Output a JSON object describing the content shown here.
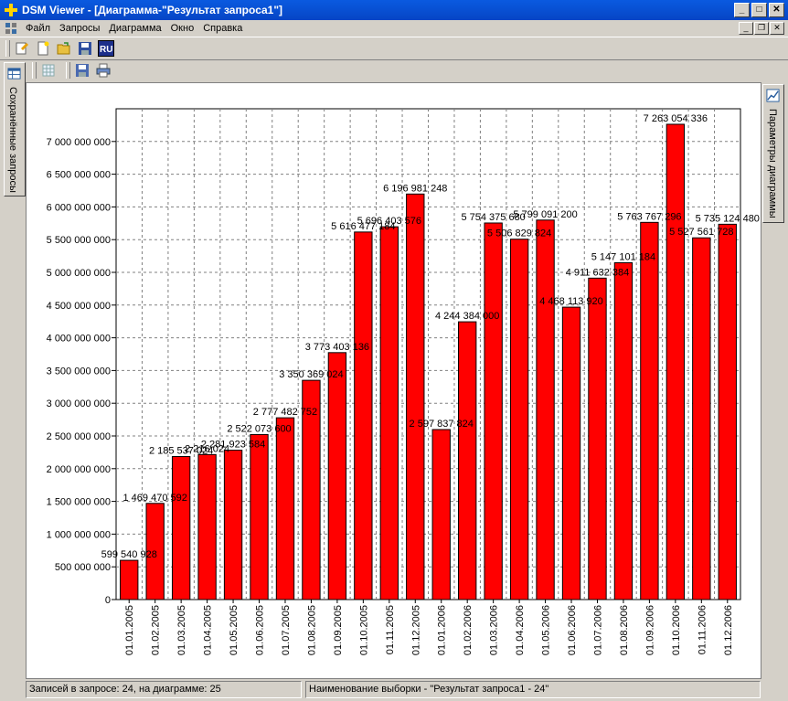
{
  "window": {
    "title": "DSM Viewer - [Диаграмма-\"Результат запроса1\"]"
  },
  "menu": {
    "items": [
      "Файл",
      "Запросы",
      "Диаграмма",
      "Окно",
      "Справка"
    ]
  },
  "left_panel": {
    "label": "Сохранённые запросы"
  },
  "right_panel": {
    "label": "Параметры диаграммы"
  },
  "statusbar": {
    "records": "Записей в запросе: 24, на диаграмме: 25",
    "selection": "Наименование выборки - \"Результат запроса1 - 24\""
  },
  "colors": {
    "bar": "#ff0000",
    "titlebar": "#0a5ae0"
  },
  "chart_data": {
    "type": "bar",
    "categories": [
      "01.01.2005",
      "01.02.2005",
      "01.03.2005",
      "01.04.2005",
      "01.05.2005",
      "01.06.2005",
      "01.07.2005",
      "01.08.2005",
      "01.09.2005",
      "01.10.2005",
      "01.11.2005",
      "01.12.2005",
      "01.01.2006",
      "01.02.2006",
      "01.03.2006",
      "01.04.2006",
      "01.05.2006",
      "01.06.2006",
      "01.07.2006",
      "01.08.2006",
      "01.09.2006",
      "01.10.2006",
      "01.11.2006",
      "01.12.2006"
    ],
    "values": [
      599540928,
      1469470592,
      2185537024,
      2216024832,
      2281923584,
      2522073600,
      2777482752,
      3350369024,
      3773403136,
      5616477184,
      5696403576,
      6196981248,
      2597837824,
      4244384000,
      5754375680,
      5506829824,
      5799091200,
      4468113920,
      4911632384,
      5147101184,
      5763767296,
      7263054336,
      5527561728,
      5735124480
    ],
    "labels": [
      "599 540 928",
      "1 469 470 592",
      "2 185 537 024",
      "2 216 024",
      "2 281 923 584",
      "2 522 073 600",
      "2 777 482 752",
      "3 350 369 024",
      "3 773 403 136",
      "5 616 477 184",
      "5 696 403 576",
      "6 196 981 248",
      "2 597 837 824",
      "4 244 384 000",
      "5 754 375 680",
      "5 506 829 824",
      "5 799 091 200",
      "4 468 113 920",
      "4 911 632 384",
      "5 147 101 184",
      "5 763 767 296",
      "7 263 054 336",
      "5 527 561 728",
      "5 735 124 480"
    ],
    "ylim": [
      0,
      7500000000
    ],
    "yticks": [
      0,
      500000000,
      1000000000,
      1500000000,
      2000000000,
      2500000000,
      3000000000,
      3500000000,
      4000000000,
      4500000000,
      5000000000,
      5500000000,
      6000000000,
      6500000000,
      7000000000
    ],
    "ytick_labels": [
      "0",
      "500 000 000",
      "1 000 000 000",
      "1 500 000 000",
      "2 000 000 000",
      "2 500 000 000",
      "3 000 000 000",
      "3 500 000 000",
      "4 000 000 000",
      "4 500 000 000",
      "5 000 000 000",
      "5 500 000 000",
      "6 000 000 000",
      "6 500 000 000",
      "7 000 000 000"
    ],
    "grid": true,
    "legend": "none"
  }
}
